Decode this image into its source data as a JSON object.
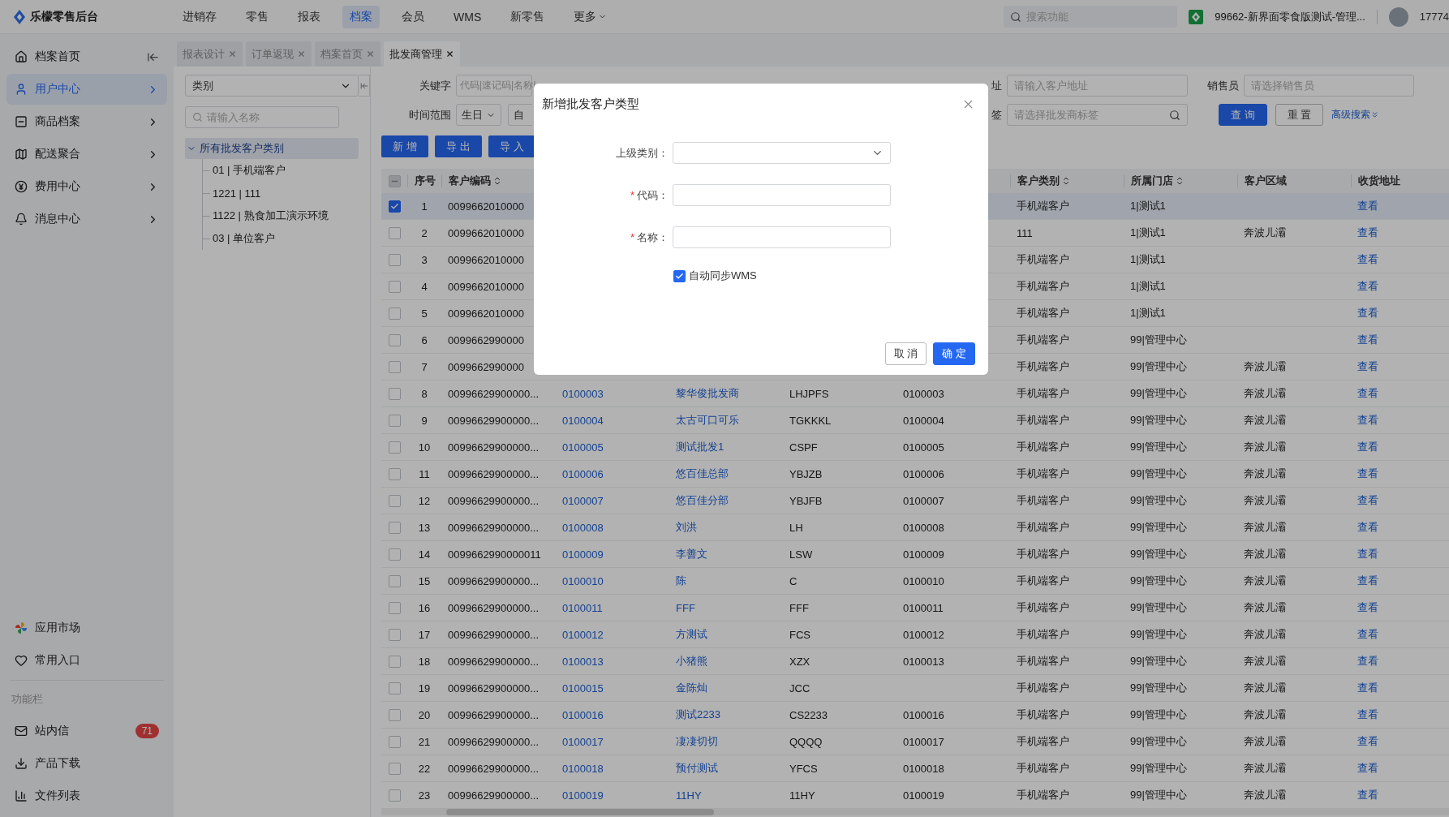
{
  "app": {
    "logo_text": "乐檬零售后台"
  },
  "nav": [
    {
      "label": "进销存",
      "selected": false
    },
    {
      "label": "零售",
      "selected": false
    },
    {
      "label": "报表",
      "selected": false
    },
    {
      "label": "档案",
      "selected": true
    },
    {
      "label": "会员",
      "selected": false
    },
    {
      "label": "WMS",
      "selected": false
    },
    {
      "label": "新零售",
      "selected": false
    },
    {
      "label": "更多",
      "selected": false,
      "kind": "dropdown"
    }
  ],
  "search": {
    "placeholder": "搜索功能"
  },
  "store": {
    "name": "99662-新界面零食版测试-管理..."
  },
  "user": {
    "name": "17774"
  },
  "sidebar": {
    "items": [
      {
        "label": "档案首页",
        "selected": false,
        "kind": "home"
      },
      {
        "label": "用户中心",
        "selected": true,
        "kind": "group"
      },
      {
        "label": "商品档案",
        "selected": false,
        "kind": "group"
      },
      {
        "label": "配送聚合",
        "selected": false,
        "kind": "group"
      },
      {
        "label": "费用中心",
        "selected": false,
        "kind": "group"
      },
      {
        "label": "消息中心",
        "selected": false,
        "kind": "group"
      }
    ],
    "bottom_items": [
      {
        "label": "应用市场"
      },
      {
        "label": "常用入口"
      }
    ],
    "section_label": "功能栏",
    "tools": [
      {
        "label": "站内信",
        "badge": "71"
      },
      {
        "label": "产品下载"
      },
      {
        "label": "文件列表"
      }
    ]
  },
  "tabs": [
    {
      "label": "报表设计",
      "selected": false
    },
    {
      "label": "订单返现",
      "selected": false
    },
    {
      "label": "档案首页",
      "selected": false
    },
    {
      "label": "批发商管理",
      "selected": true
    }
  ],
  "category_panel": {
    "select": "类别",
    "search_placeholder": "请输入名称",
    "tree": [
      {
        "label": "所有批发客户类别",
        "expanded": true,
        "selected": true,
        "children": [
          {
            "label": "01 | 手机端客户",
            "selected": false
          },
          {
            "label": "1221 | 111",
            "selected": false
          },
          {
            "label": "1122 | 熟食加工演示环境",
            "selected": false
          },
          {
            "label": "03 | 单位客户",
            "selected": false
          }
        ]
      }
    ]
  },
  "filters": {
    "keyword": {
      "label": "关键字",
      "placeholder": "代码|速记码|名称|"
    },
    "time_range": {
      "label": "时间范围",
      "value": "生日",
      "partial_value": "自"
    },
    "address": {
      "label": "址",
      "placeholder": "请输入客户地址"
    },
    "salesperson": {
      "label": "销售员",
      "placeholder": "请选择销售员"
    },
    "tag": {
      "label": "签",
      "placeholder": "请选择批发商标签"
    },
    "buttons": [
      {
        "label": "查 询",
        "kind": "primary"
      },
      {
        "label": "重 置",
        "kind": "secondary"
      }
    ],
    "advanced": "高级搜索"
  },
  "actions": [
    "新 增",
    "导 出",
    "导 入"
  ],
  "table": {
    "select_all": {
      "checked": false,
      "indeterminate": true
    },
    "columns": [
      {
        "label": "序号",
        "kind": "text",
        "sortable": false
      },
      {
        "label": "客户编码",
        "kind": "text",
        "sortable": true
      },
      {
        "kind": "link"
      },
      {
        "kind": "link"
      },
      {
        "kind": "text"
      },
      {
        "kind": "text"
      },
      {
        "label": "客户类别",
        "kind": "text",
        "sortable": true
      },
      {
        "label": "所属门店",
        "kind": "text",
        "sortable": true
      },
      {
        "label": "客户区域",
        "kind": "text",
        "sortable": false
      },
      {
        "label": "收货地址",
        "kind": "link",
        "sortable": false
      }
    ],
    "rows": [
      {
        "selected": true,
        "cells": [
          "1",
          "0099662010000",
          null,
          null,
          null,
          null,
          "手机端客户",
          "1|测试1",
          null,
          "查看"
        ]
      },
      {
        "selected": false,
        "cells": [
          "2",
          "0099662010000",
          null,
          null,
          null,
          null,
          "111",
          "1|测试1",
          "奔波儿灞",
          "查看"
        ]
      },
      {
        "selected": false,
        "cells": [
          "3",
          "0099662010000",
          null,
          null,
          null,
          null,
          "手机端客户",
          "1|测试1",
          null,
          "查看"
        ]
      },
      {
        "selected": false,
        "cells": [
          "4",
          "0099662010000",
          null,
          null,
          null,
          null,
          "手机端客户",
          "1|测试1",
          null,
          "查看"
        ]
      },
      {
        "selected": false,
        "cells": [
          "5",
          "0099662010000",
          null,
          null,
          null,
          null,
          "手机端客户",
          "1|测试1",
          null,
          "查看"
        ]
      },
      {
        "selected": false,
        "cells": [
          "6",
          "0099662990000",
          null,
          null,
          null,
          null,
          "手机端客户",
          "99|管理中心",
          null,
          "查看"
        ]
      },
      {
        "selected": false,
        "cells": [
          "7",
          "0099662990000",
          null,
          null,
          null,
          null,
          "手机端客户",
          "99|管理中心",
          "奔波儿灞",
          "查看"
        ]
      },
      {
        "selected": false,
        "cells": [
          "8",
          "00996629900000...",
          "0100003",
          "黎华俊批发商",
          "LHJPFS",
          "0100003",
          "手机端客户",
          "99|管理中心",
          "奔波儿灞",
          "查看"
        ]
      },
      {
        "selected": false,
        "cells": [
          "9",
          "00996629900000...",
          "0100004",
          "太古可口可乐",
          "TGKKKL",
          "0100004",
          "手机端客户",
          "99|管理中心",
          "奔波儿灞",
          "查看"
        ]
      },
      {
        "selected": false,
        "cells": [
          "10",
          "00996629900000...",
          "0100005",
          "测试批发1",
          "CSPF",
          "0100005",
          "手机端客户",
          "99|管理中心",
          "奔波儿灞",
          "查看"
        ]
      },
      {
        "selected": false,
        "cells": [
          "11",
          "00996629900000...",
          "0100006",
          "悠百佳总部",
          "YBJZB",
          "0100006",
          "手机端客户",
          "99|管理中心",
          "奔波儿灞",
          "查看"
        ]
      },
      {
        "selected": false,
        "cells": [
          "12",
          "00996629900000...",
          "0100007",
          "悠百佳分部",
          "YBJFB",
          "0100007",
          "手机端客户",
          "99|管理中心",
          "奔波儿灞",
          "查看"
        ]
      },
      {
        "selected": false,
        "cells": [
          "13",
          "00996629900000...",
          "0100008",
          "刘洪",
          "LH",
          "0100008",
          "手机端客户",
          "99|管理中心",
          "奔波儿灞",
          "查看"
        ]
      },
      {
        "selected": false,
        "cells": [
          "14",
          "0099662990000011",
          "0100009",
          "李善文",
          "LSW",
          "0100009",
          "手机端客户",
          "99|管理中心",
          "奔波儿灞",
          "查看"
        ]
      },
      {
        "selected": false,
        "cells": [
          "15",
          "00996629900000...",
          "0100010",
          "陈",
          "C",
          "0100010",
          "手机端客户",
          "99|管理中心",
          "奔波儿灞",
          "查看"
        ]
      },
      {
        "selected": false,
        "cells": [
          "16",
          "00996629900000...",
          "0100011",
          "FFF",
          "FFF",
          "0100011",
          "手机端客户",
          "99|管理中心",
          "奔波儿灞",
          "查看"
        ]
      },
      {
        "selected": false,
        "cells": [
          "17",
          "00996629900000...",
          "0100012",
          "方测试",
          "FCS",
          "0100012",
          "手机端客户",
          "99|管理中心",
          "奔波儿灞",
          "查看"
        ]
      },
      {
        "selected": false,
        "cells": [
          "18",
          "00996629900000...",
          "0100013",
          "小猪熊",
          "XZX",
          "0100013",
          "手机端客户",
          "99|管理中心",
          "奔波儿灞",
          "查看"
        ]
      },
      {
        "selected": false,
        "cells": [
          "19",
          "00996629900000...",
          "0100015",
          "金陈灿",
          "JCC",
          null,
          "手机端客户",
          "99|管理中心",
          "奔波儿灞",
          "查看"
        ]
      },
      {
        "selected": false,
        "cells": [
          "20",
          "00996629900000...",
          "0100016",
          "测试2233",
          "CS2233",
          "0100016",
          "手机端客户",
          "99|管理中心",
          "奔波儿灞",
          "查看"
        ]
      },
      {
        "selected": false,
        "cells": [
          "21",
          "00996629900000...",
          "0100017",
          "凄凄切切",
          "QQQQ",
          "0100017",
          "手机端客户",
          "99|管理中心",
          "奔波儿灞",
          "查看"
        ]
      },
      {
        "selected": false,
        "cells": [
          "22",
          "00996629900000...",
          "0100018",
          "预付测试",
          "YFCS",
          "0100018",
          "手机端客户",
          "99|管理中心",
          "奔波儿灞",
          "查看"
        ]
      },
      {
        "selected": false,
        "cells": [
          "23",
          "00996629900000...",
          "0100019",
          "11HY",
          "11HY",
          "0100019",
          "手机端客户",
          "99|管理中心",
          "奔波儿灞",
          "查看"
        ]
      }
    ]
  },
  "modal": {
    "title": "新增批发客户类型",
    "fields": [
      {
        "label": "上级类别：",
        "kind": "select"
      },
      {
        "label": "代码：",
        "kind": "input",
        "required_mark": "*"
      },
      {
        "label": "名称：",
        "kind": "input",
        "required_mark": "*"
      }
    ],
    "checkbox": {
      "label": "自动同步WMS",
      "checked": true
    },
    "buttons": [
      {
        "label": "取 消",
        "kind": "secondary"
      },
      {
        "label": "确 定",
        "kind": "primary"
      }
    ]
  }
}
